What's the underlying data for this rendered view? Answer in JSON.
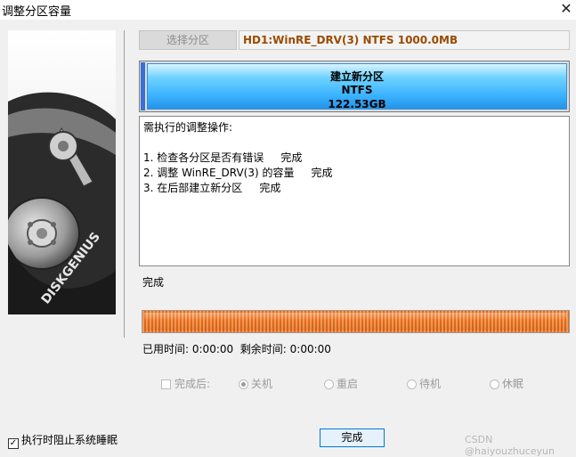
{
  "window": {
    "title": "调整分区容量"
  },
  "header": {
    "choose_partition_label": "选择分区",
    "partition_info": "HD1:WinRE_DRV(3) NTFS 1000.0MB"
  },
  "disk_map": {
    "line1": "建立新分区",
    "line2": "NTFS",
    "line3": "122.53GB"
  },
  "operations": {
    "heading": "需执行的调整操作:",
    "items": [
      "1. 检查各分区是否有错误     完成",
      "2. 调整 WinRE_DRV(3) 的容量     完成",
      "3. 在后部建立新分区     完成"
    ]
  },
  "status": {
    "text": "完成",
    "progress": 1.0,
    "elapsed_label": "已用时间:",
    "elapsed_value": "0:00:00",
    "remaining_label": "剩余时间:",
    "remaining_value": "0:00:00"
  },
  "after_options": {
    "after_label": "完成后:",
    "shutdown": "关机",
    "restart": "重启",
    "standby": "待机",
    "hibernate": "休眠"
  },
  "footer": {
    "prevent_sleep_label": "执行时阻止系统睡眠",
    "done_button": "完成",
    "watermark": "CSDN @haiyouzhuceyun"
  },
  "brand": {
    "logo_text": "DISKGENIUS"
  },
  "colors": {
    "accent_blue": "#3bb3ff",
    "progress_orange": "#e36a1a",
    "partition_text": "#9a4b00"
  }
}
